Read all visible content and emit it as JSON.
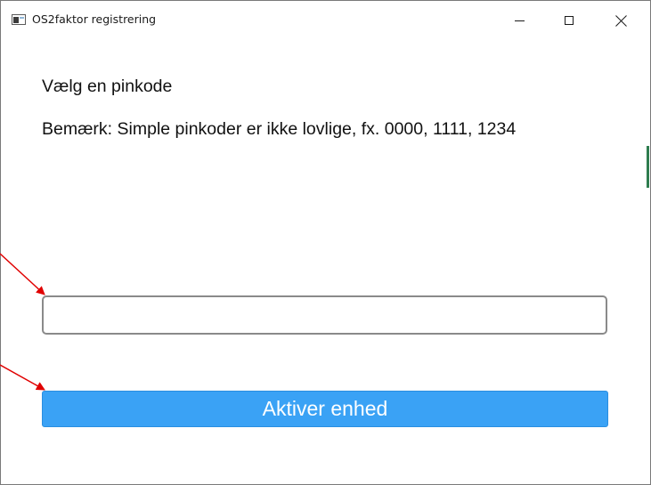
{
  "window": {
    "title": "OS2faktor registrering"
  },
  "form": {
    "heading": "Vælg en pinkode",
    "note": "Bemærk: Simple pinkoder er ikke lovlige, fx. 0000, 1111, 1234",
    "pin_value": "",
    "pin_placeholder": "",
    "activate_label": "Aktiver enhed"
  },
  "colors": {
    "accent": "#3aa2f5",
    "arrow": "#e00000"
  },
  "icons": {
    "minimize": "minimize-icon",
    "maximize": "maximize-icon",
    "close": "close-icon"
  }
}
